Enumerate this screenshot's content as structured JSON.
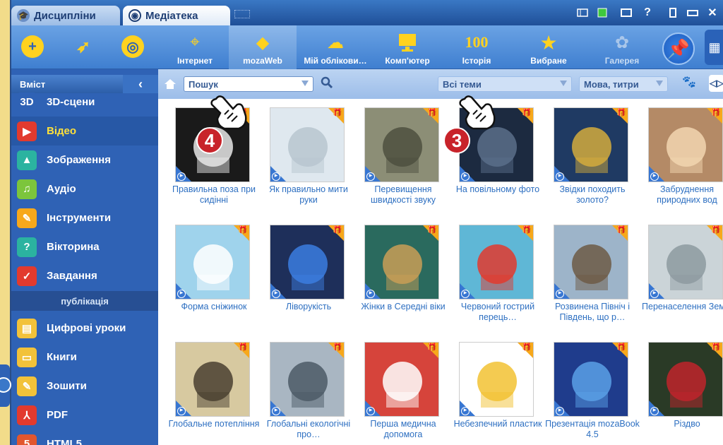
{
  "tabs": [
    {
      "label": "Дисципліни",
      "icon": "graduation-cap-icon"
    },
    {
      "label": "Медіатека",
      "icon": "mediateka-icon"
    }
  ],
  "window_controls": [
    "layout-icon",
    "screen-icon",
    "monitor-icon",
    "help-icon",
    "window-icon",
    "minimize-icon",
    "close-icon"
  ],
  "window_glyphs": {
    "help": "?",
    "close": "✕"
  },
  "toolbar_left": [
    {
      "name": "add",
      "glyph": "+",
      "color": "#ffd21f"
    },
    {
      "name": "rocket",
      "glyph": "🚀",
      "color": "#ffd21f"
    },
    {
      "name": "target",
      "glyph": "◎",
      "color": "#ffd21f"
    }
  ],
  "toolbar": [
    {
      "label": "Інтернет",
      "glyph": "🖱",
      "icon": "internet-icon"
    },
    {
      "label": "mozaWeb",
      "glyph": "◆",
      "icon": "mozaweb-icon",
      "selected": true
    },
    {
      "label": "Мій облікови…",
      "glyph": "☁",
      "icon": "cloud-account-icon"
    },
    {
      "label": "Комп'ютер",
      "glyph": "🖥",
      "icon": "computer-icon"
    },
    {
      "label": "Історія",
      "glyph": "100",
      "icon": "history-icon"
    },
    {
      "label": "Вибране",
      "glyph": "★",
      "icon": "star-icon"
    },
    {
      "label": "Галерея",
      "glyph": "✿",
      "icon": "gallery-icon",
      "disabled": true
    }
  ],
  "sidebar": {
    "header": "Вміст",
    "collapse_glyph": "‹",
    "items": [
      {
        "label": "3D-сцени",
        "icon": "3d-icon",
        "glyph": "3D",
        "color": "#2f62b5"
      },
      {
        "label": "Відео",
        "icon": "video-icon",
        "glyph": "▶",
        "color": "#e23a2e",
        "selected": true
      },
      {
        "label": "Зображення",
        "icon": "image-icon",
        "glyph": "▲",
        "color": "#2bb3a0"
      },
      {
        "label": "Аудіо",
        "icon": "audio-icon",
        "glyph": "♫",
        "color": "#7cc53c"
      },
      {
        "label": "Інструменти",
        "icon": "tools-icon",
        "glyph": "✎",
        "color": "#f7a81b"
      },
      {
        "label": "Вікторина",
        "icon": "quiz-icon",
        "glyph": "?",
        "color": "#2bb3a0"
      },
      {
        "label": "Завдання",
        "icon": "tasks-icon",
        "glyph": "✓",
        "color": "#e23a2e"
      }
    ],
    "section": "публікація",
    "pub_items": [
      {
        "label": "Цифрові уроки",
        "icon": "digital-lessons-icon",
        "glyph": "▤",
        "color": "#f2c23a"
      },
      {
        "label": "Книги",
        "icon": "books-icon",
        "glyph": "▭",
        "color": "#f2c23a"
      },
      {
        "label": "Зошити",
        "icon": "notebooks-icon",
        "glyph": "✎",
        "color": "#f2c23a"
      },
      {
        "label": "PDF",
        "icon": "pdf-icon",
        "glyph": "⅄",
        "color": "#e23a2e"
      },
      {
        "label": "HTML5",
        "icon": "html5-icon",
        "glyph": "5",
        "color": "#e2562e"
      }
    ]
  },
  "filters": {
    "home_glyph": "⌂",
    "search_glyph": "🔍",
    "paw_glyph": "🐾",
    "arrows_glyph": "◁▷",
    "search_placeholder": "Пошук",
    "topics": "Всі теми",
    "language": "Мова, титри"
  },
  "gift_glyph": "🎁",
  "play_glyph": "▶",
  "cards": [
    {
      "title": "Правильна поза при сидінні",
      "bg": "#1a1a1a",
      "fg": "#e8e8e8"
    },
    {
      "title": "Як правильно мити руки",
      "bg": "#dfe8ef",
      "fg": "#b8c6cf"
    },
    {
      "title": "Перевищення швидкості звуку",
      "bg": "#8c8e76",
      "fg": "#4e5040"
    },
    {
      "title": "На повільному фото",
      "bg": "#1c2a40",
      "fg": "#5a6e8a"
    },
    {
      "title": "Звідки походить золото?",
      "bg": "#1f3a63",
      "fg": "#d4ab3c"
    },
    {
      "title": "Забруднення природних вод",
      "bg": "#b48a66",
      "fg": "#f2d5b0"
    },
    {
      "title": "Форма сніжинок",
      "bg": "#9fd3ec",
      "fg": "#ffffff"
    },
    {
      "title": "Ліворукість",
      "bg": "#1e2f5a",
      "fg": "#3b7de0"
    },
    {
      "title": "Жінки в Середні віки",
      "bg": "#2a6a5e",
      "fg": "#c99e56"
    },
    {
      "title": "Червоний гострий перець…",
      "bg": "#5fb7d6",
      "fg": "#e23a2e"
    },
    {
      "title": "Розвинена Північ і Південь, що р…",
      "bg": "#9db4c9",
      "fg": "#6d5a45"
    },
    {
      "title": "Перенаселення Землі",
      "bg": "#cbd4d8",
      "fg": "#8d9aa0"
    },
    {
      "title": "Глобальне потепління",
      "bg": "#d7c9a0",
      "fg": "#4a4030"
    },
    {
      "title": "Глобальні екологічні про…",
      "bg": "#a9b6c2",
      "fg": "#4c5a66"
    },
    {
      "title": "Перша медична допомога",
      "bg": "#d6443b",
      "fg": "#ffffff"
    },
    {
      "title": "Небезпечний пластик",
      "bg": "#ffffff",
      "fg": "#f2c232"
    },
    {
      "title": "Презентація mozaBook 4.5",
      "bg": "#1f3c8c",
      "fg": "#5aa0e6"
    },
    {
      "title": "Різдво",
      "bg": "#2a3a26",
      "fg": "#c0242c"
    }
  ],
  "callouts": [
    {
      "number": "4",
      "target": "search"
    },
    {
      "number": "3",
      "target": "topics"
    }
  ],
  "colors": {
    "accent": "#3f7fd0",
    "link": "#2d6fc1",
    "selected_text": "#ffe13a",
    "badge": "#c8232a"
  }
}
